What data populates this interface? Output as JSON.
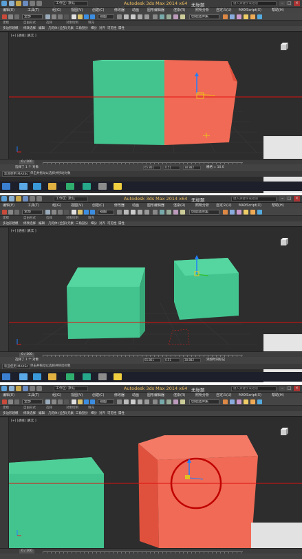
{
  "screens": [
    {
      "app_title": "Autodesk 3ds Max  2014 x64",
      "file_title": "无标题",
      "workspace": "工作区: 默认",
      "search_placeholder": "键入关键字或短语",
      "menus": [
        "编辑(E)",
        "工具(T)",
        "组(G)",
        "视图(V)",
        "创建(C)",
        "修改器",
        "动画",
        "图形编辑器",
        "渲染(R)",
        "照明分析",
        "自定义(U)",
        "MAXScript(X)",
        "帮助(H)"
      ],
      "filter_select": "全部",
      "view_select": "视图",
      "selection_set": "创建选择集",
      "ribbon_tabs": [
        "建模",
        "自由形式",
        "选择",
        "对象绘制",
        "填充"
      ],
      "ribbon_tools": [
        "多边形建模",
        "修改选择",
        "编辑",
        "几何体 (全部)",
        "元素",
        "三角剖分",
        "细分",
        "对齐",
        "可见性",
        "属性"
      ],
      "viewport_label": "[+] [透视] [真实 ]",
      "frame_counter": "0 / 100",
      "selection_status": "选择了 1 个 对象",
      "prompt_text": "单击并拖动以选择并移动对象",
      "coords": {
        "x": "65.861",
        "y": "0.51",
        "z": "38.882"
      },
      "grid_text": "栅格 = 10.0",
      "welcome": "欢迎使用 MAXSc"
    },
    {
      "app_title": "Autodesk 3ds Max  2014 x64",
      "file_title": "无标题",
      "workspace": "工作区: 默认",
      "search_placeholder": "键入关键字或短语",
      "menus": [
        "编辑(E)",
        "工具(T)",
        "组(G)",
        "视图(V)",
        "创建(C)",
        "修改器",
        "动画",
        "图形编辑器",
        "渲染(R)",
        "照明分析",
        "自定义(U)",
        "MAXScript(X)",
        "帮助(H)"
      ],
      "filter_select": "全部",
      "view_select": "视图",
      "selection_set": "创建选择集",
      "ribbon_tabs": [
        "建模",
        "自由形式",
        "选择",
        "对象绘制",
        "填充"
      ],
      "ribbon_tools": [
        "多边形建模",
        "修改选择",
        "编辑",
        "几何体 (全部)",
        "元素",
        "三角剖分",
        "细分",
        "对齐",
        "可见性",
        "属性"
      ],
      "viewport_label": "[+] [透视] [真实 ]",
      "frame_counter": "0 / 100",
      "selection_status": "选择了 1 个 对象",
      "prompt_text": "单击并拖动以选择并移动对象",
      "coords": {
        "x": "65.861",
        "y": "0.51",
        "z": "38.882"
      },
      "grid_text": "添加时间标记",
      "welcome": "欢迎使用 MAXSc"
    },
    {
      "app_title": "Autodesk 3ds Max  2014 x64",
      "file_title": "无标题",
      "workspace": "工作区: 默认",
      "search_placeholder": "键入关键字或短语",
      "menus": [
        "编辑(E)",
        "工具(T)",
        "组(G)",
        "视图(V)",
        "创建(C)",
        "修改器",
        "动画",
        "图形编辑器",
        "渲染(R)",
        "照明分析",
        "自定义(U)",
        "MAXScript(X)",
        "帮助(H)"
      ],
      "filter_select": "全部",
      "view_select": "视图",
      "selection_set": "创建选择集",
      "ribbon_tabs": [
        "建模",
        "自由形式",
        "选择",
        "对象绘制",
        "填充"
      ],
      "ribbon_tools": [
        "多边形建模",
        "修改选择",
        "编辑",
        "几何体 (全部)",
        "元素",
        "三角剖分",
        "细分",
        "对齐",
        "可见性",
        "属性"
      ],
      "viewport_label": "[+] [透视] [真实 ]",
      "frame_counter": "0 / 100",
      "selection_status": "",
      "prompt_text": "",
      "coords": {
        "x": "",
        "y": "",
        "z": ""
      },
      "grid_text": "",
      "welcome": ""
    }
  ],
  "colors": {
    "green_box": "#43c48f",
    "green_box_side": "#37a878",
    "orange_box": "#f06a55",
    "orange_box_side": "#e0513d",
    "red_line": "#e01010",
    "app_title": "#f0c060"
  },
  "icons": [
    "app-icon",
    "new-icon",
    "open-icon",
    "save-icon",
    "undo-icon",
    "redo-icon",
    "select-icon",
    "move-icon",
    "rotate-icon",
    "scale-icon",
    "snap-icon",
    "render-icon",
    "help-icon",
    "minimize-icon",
    "maximize-icon",
    "close-icon",
    "windows-start-icon",
    "home-icon",
    "ie-icon",
    "folder-icon",
    "3dsmax-icon",
    "music-icon",
    "chat-icon"
  ]
}
